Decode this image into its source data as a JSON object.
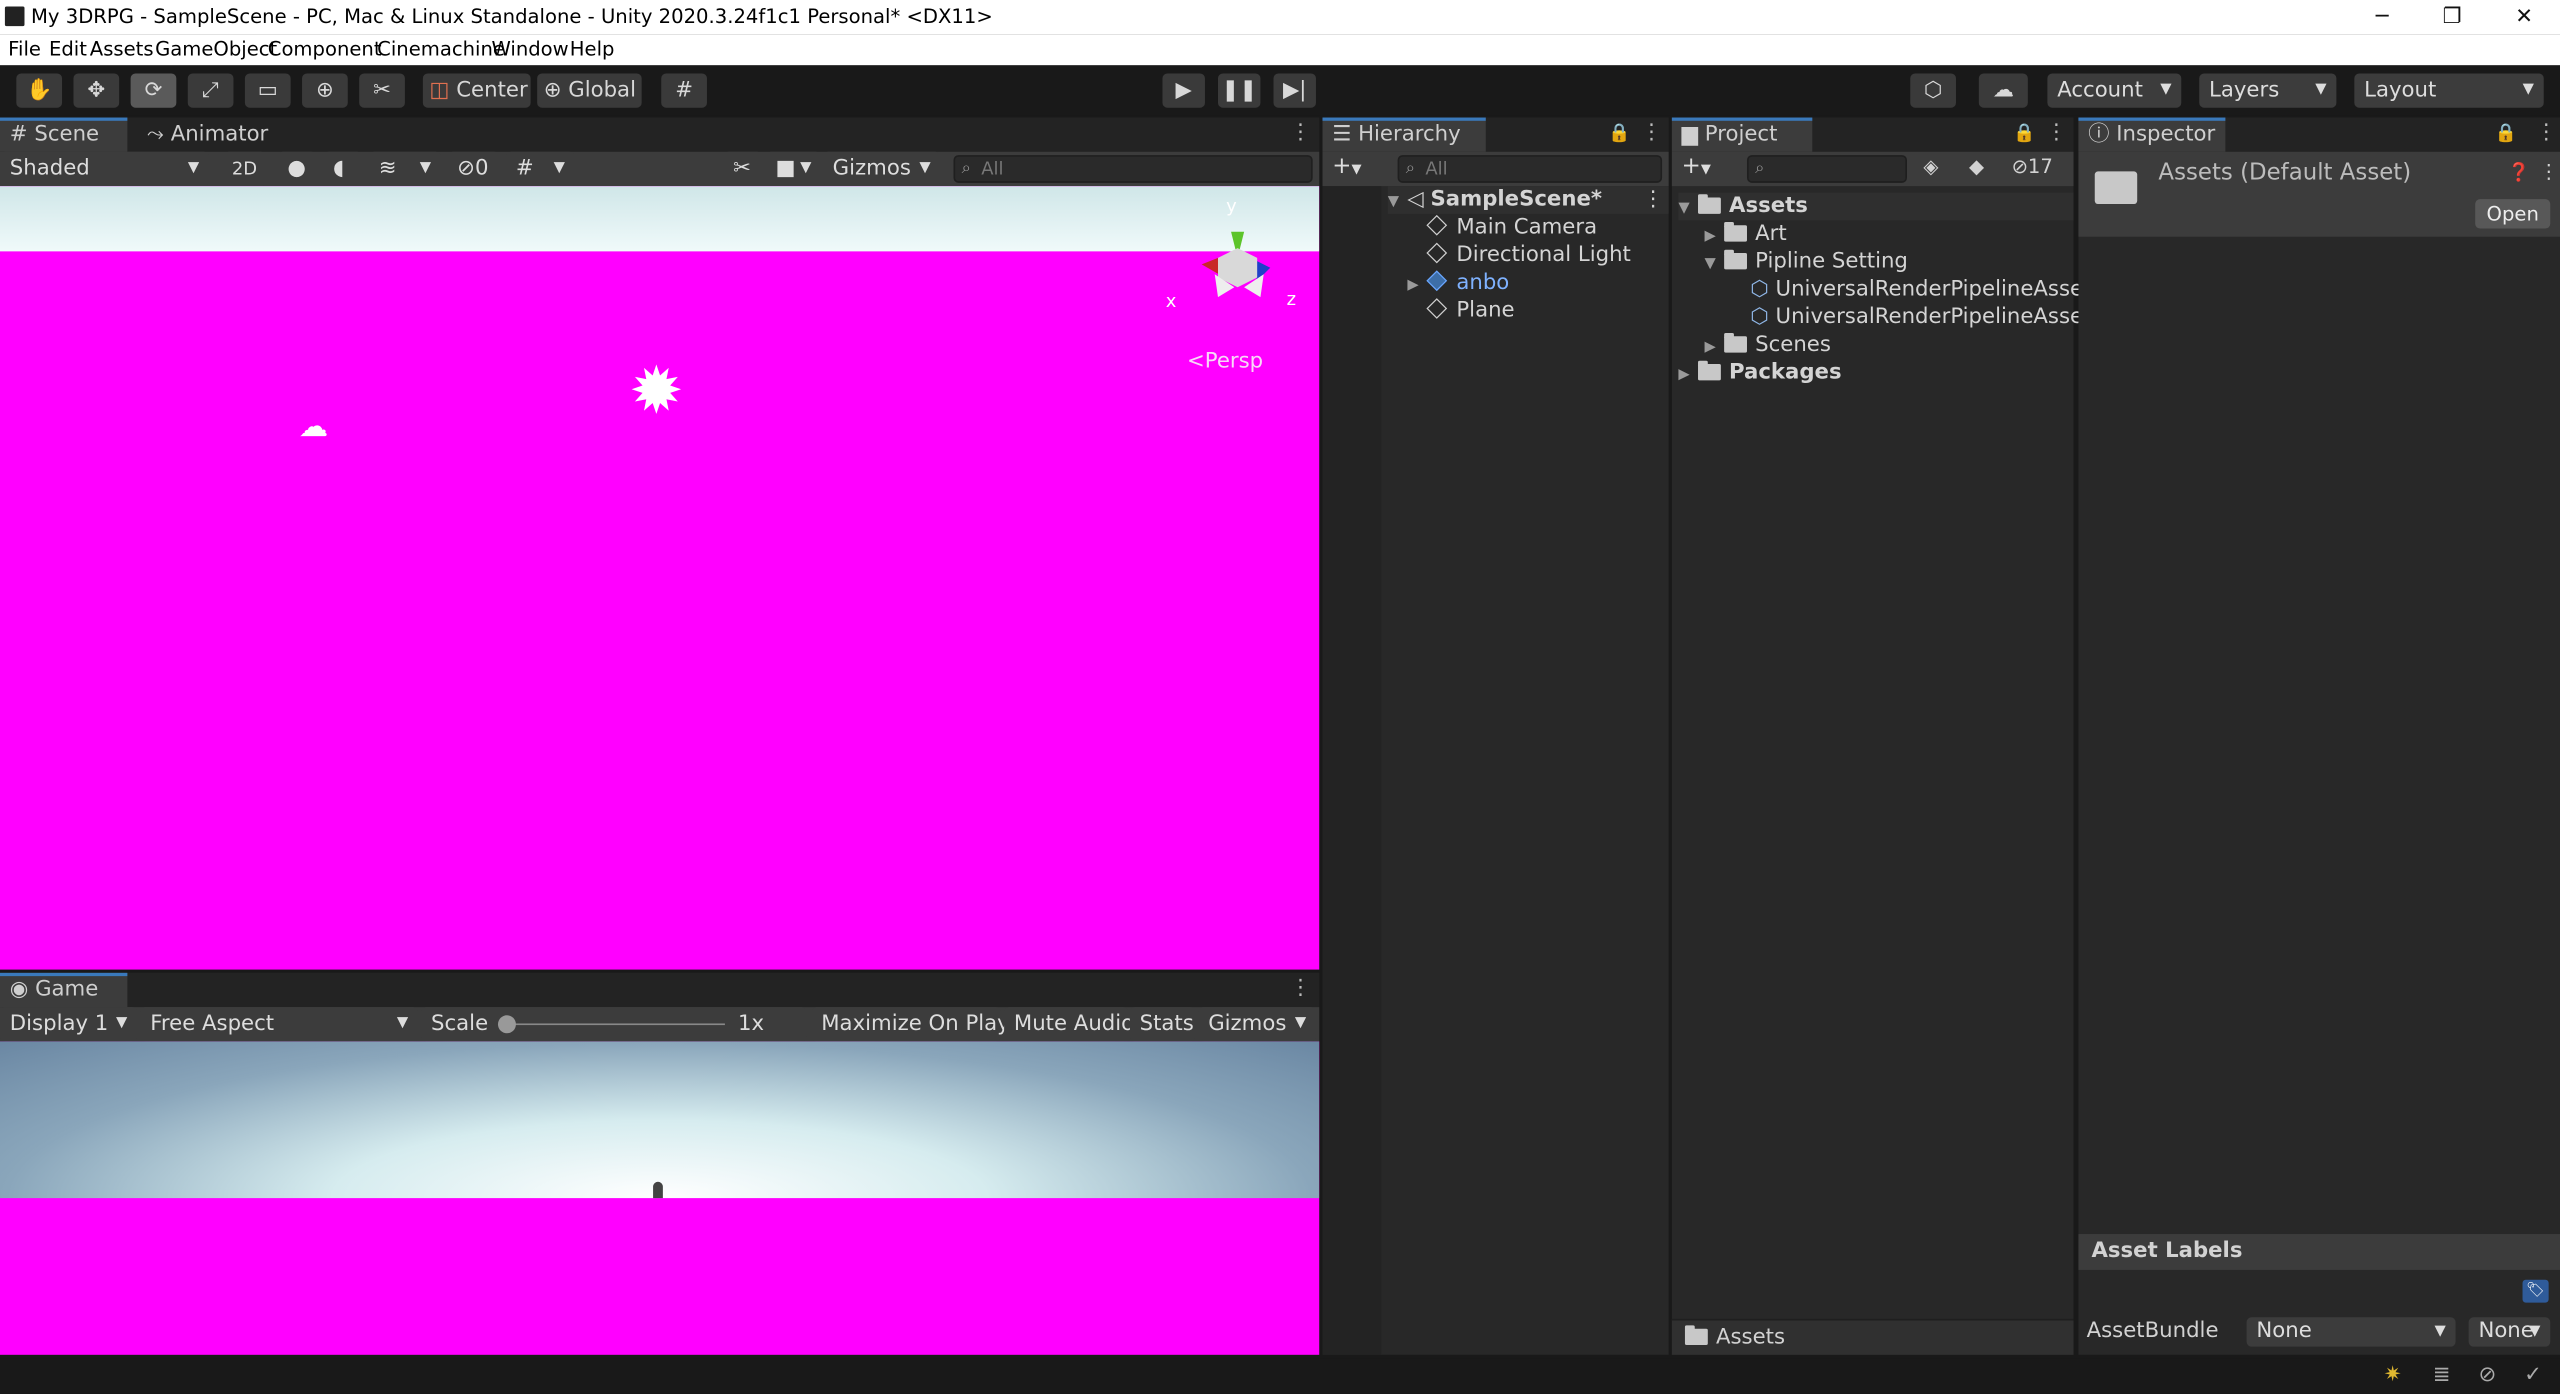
{
  "window": {
    "title": "My 3DRPG - SampleScene - PC, Mac & Linux Standalone - Unity 2020.3.24f1c1 Personal* <DX11>",
    "minimize": "─",
    "restore": "❐",
    "close": "✕"
  },
  "menu": [
    "File",
    "Edit",
    "Assets",
    "GameObject",
    "Component",
    "Cinemachine",
    "Window",
    "Help"
  ],
  "toolbar": {
    "pivot": "Center",
    "space": "Global",
    "account": "Account",
    "layers": "Layers",
    "layout": "Layout",
    "tool_icons": [
      "hand-icon",
      "move-icon",
      "rotate-icon",
      "scale-icon",
      "rect-icon",
      "transform-icon",
      "custom-tool-icon"
    ]
  },
  "scene_panel": {
    "tabs": [
      "Scene",
      "Animator"
    ],
    "shading": "Shaded",
    "mode_2d": "2D",
    "hidden_count": "0",
    "gizmos": "Gizmos",
    "search_placeholder": "All",
    "persp_label": "Persp",
    "axis": {
      "x": "x",
      "y": "y",
      "z": "z"
    }
  },
  "game_panel": {
    "tab": "Game",
    "display": "Display 1",
    "aspect": "Free Aspect",
    "scale_label": "Scale",
    "scale_value": "1x",
    "maximize": "Maximize On Play",
    "mute": "Mute Audio",
    "stats": "Stats",
    "gizmos": "Gizmos"
  },
  "hierarchy": {
    "tab": "Hierarchy",
    "search_placeholder": "All",
    "scene": "SampleScene*",
    "items": [
      {
        "label": "Main Camera",
        "expandable": false,
        "prefab": false
      },
      {
        "label": "Directional Light",
        "expandable": false,
        "prefab": false
      },
      {
        "label": "anbo",
        "expandable": true,
        "prefab": true
      },
      {
        "label": "Plane",
        "expandable": false,
        "prefab": false
      }
    ]
  },
  "project": {
    "tab": "Project",
    "hidden_count": "17",
    "tree": [
      {
        "label": "Assets",
        "depth": 0,
        "bold": true,
        "state": "open"
      },
      {
        "label": "Art",
        "depth": 1,
        "state": "closed"
      },
      {
        "label": "Pipline Setting",
        "depth": 1,
        "state": "open"
      },
      {
        "label": "UniversalRenderPipelineAsset",
        "depth": 2,
        "state": "leaf"
      },
      {
        "label": "UniversalRenderPipelineAsset",
        "depth": 2,
        "state": "leaf"
      },
      {
        "label": "Scenes",
        "depth": 1,
        "state": "closed"
      },
      {
        "label": "Packages",
        "depth": 0,
        "bold": true,
        "state": "closed"
      }
    ],
    "footer": "Assets"
  },
  "inspector": {
    "tab": "Inspector",
    "asset_title": "Assets (Default Asset)",
    "open_button": "Open",
    "labels_header": "Asset Labels",
    "assetbundle_label": "AssetBundle",
    "assetbundle_value": "None",
    "variant_value": "None"
  },
  "colors": {
    "magenta": "#ff00ff",
    "accent": "#3a79bb",
    "panel": "#282828"
  }
}
